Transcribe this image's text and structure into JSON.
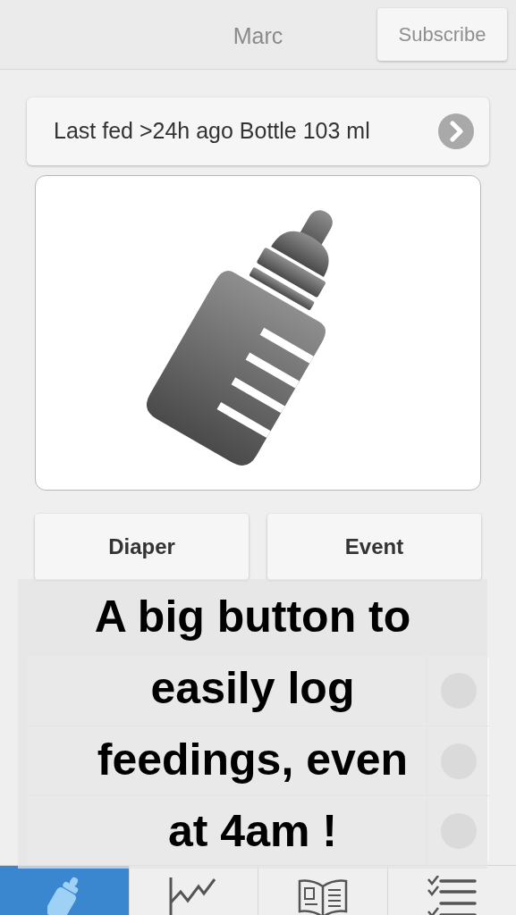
{
  "header": {
    "title": "Marc",
    "subscribe_button": "Subscribe"
  },
  "last_fed": {
    "text": "Last fed >24h ago Bottle 103 ml"
  },
  "big_button": {
    "kind": "picture"
  },
  "actions": [
    "Diaper",
    "Event"
  ],
  "reminders": [
    {
      "done": false
    },
    {
      "done": false
    },
    {
      "done": false
    }
  ],
  "caption": [
    "A big button to",
    "easily log",
    "feedings, even",
    "at 4am !"
  ],
  "tabs": [
    {
      "kind": "bottle",
      "selected": true
    },
    {
      "kind": "chart",
      "selected": false
    },
    {
      "kind": "book",
      "selected": false
    },
    {
      "kind": "checklist",
      "selected": false
    }
  ]
}
